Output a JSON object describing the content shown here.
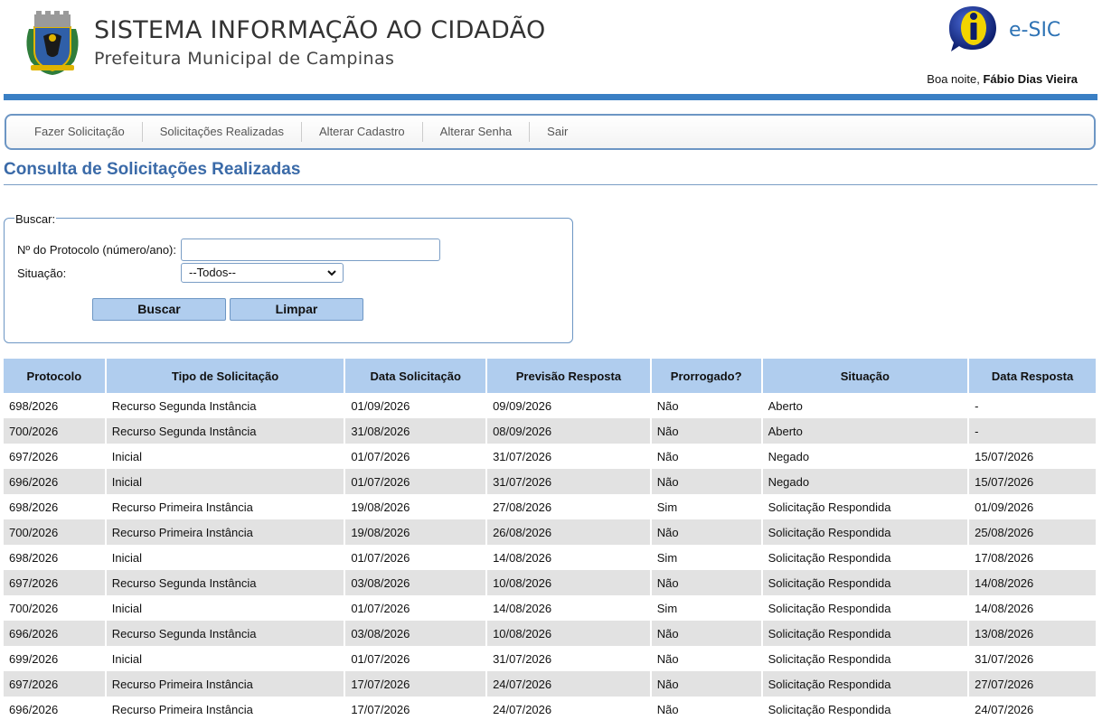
{
  "header": {
    "title": "SISTEMA INFORMAÇÃO AO CIDADÃO",
    "subtitle": "Prefeitura Municipal de Campinas",
    "logo_icon": "campinas-crest-icon",
    "esic_icon": "info-icon",
    "esic_label": "e-SIC",
    "greeting_prefix": "Boa noite,",
    "user_name": "Fábio Dias Vieira"
  },
  "menu": {
    "items": [
      {
        "label": "Fazer Solicitação"
      },
      {
        "label": "Solicitações Realizadas"
      },
      {
        "label": "Alterar Cadastro"
      },
      {
        "label": "Alterar Senha"
      },
      {
        "label": "Sair"
      }
    ]
  },
  "page": {
    "title": "Consulta de Solicitações Realizadas"
  },
  "search": {
    "legend": "Buscar:",
    "protocol_label": "Nº do Protocolo (número/ano):",
    "protocol_value": "",
    "situation_label": "Situação:",
    "situation_selected": "--Todos--",
    "search_button": "Buscar",
    "clear_button": "Limpar"
  },
  "table": {
    "columns": [
      "Protocolo",
      "Tipo de Solicitação",
      "Data Solicitação",
      "Previsão Resposta",
      "Prorrogado?",
      "Situação",
      "Data Resposta"
    ],
    "rows": [
      [
        "698/2026",
        "Recurso Segunda Instância",
        "01/09/2026",
        "09/09/2026",
        "Não",
        "Aberto",
        "-"
      ],
      [
        "700/2026",
        "Recurso Segunda Instância",
        "31/08/2026",
        "08/09/2026",
        "Não",
        "Aberto",
        "-"
      ],
      [
        "697/2026",
        "Inicial",
        "01/07/2026",
        "31/07/2026",
        "Não",
        "Negado",
        "15/07/2026"
      ],
      [
        "696/2026",
        "Inicial",
        "01/07/2026",
        "31/07/2026",
        "Não",
        "Negado",
        "15/07/2026"
      ],
      [
        "698/2026",
        "Recurso Primeira Instância",
        "19/08/2026",
        "27/08/2026",
        "Sim",
        "Solicitação Respondida",
        "01/09/2026"
      ],
      [
        "700/2026",
        "Recurso Primeira Instância",
        "19/08/2026",
        "26/08/2026",
        "Não",
        "Solicitação Respondida",
        "25/08/2026"
      ],
      [
        "698/2026",
        "Inicial",
        "01/07/2026",
        "14/08/2026",
        "Sim",
        "Solicitação Respondida",
        "17/08/2026"
      ],
      [
        "697/2026",
        "Recurso Segunda Instância",
        "03/08/2026",
        "10/08/2026",
        "Não",
        "Solicitação Respondida",
        "14/08/2026"
      ],
      [
        "700/2026",
        "Inicial",
        "01/07/2026",
        "14/08/2026",
        "Sim",
        "Solicitação Respondida",
        "14/08/2026"
      ],
      [
        "696/2026",
        "Recurso Segunda Instância",
        "03/08/2026",
        "10/08/2026",
        "Não",
        "Solicitação Respondida",
        "13/08/2026"
      ],
      [
        "699/2026",
        "Inicial",
        "01/07/2026",
        "31/07/2026",
        "Não",
        "Solicitação Respondida",
        "31/07/2026"
      ],
      [
        "697/2026",
        "Recurso Primeira Instância",
        "17/07/2026",
        "24/07/2026",
        "Não",
        "Solicitação Respondida",
        "27/07/2026"
      ],
      [
        "696/2026",
        "Recurso Primeira Instância",
        "17/07/2026",
        "24/07/2026",
        "Não",
        "Solicitação Respondida",
        "24/07/2026"
      ]
    ]
  },
  "colors": {
    "accent_blue": "#3a7fc4",
    "title_blue": "#3a6aa8",
    "header_cell": "#b0cdee",
    "row_alt": "#e2e2e2",
    "border_blue": "#6d96c4"
  }
}
